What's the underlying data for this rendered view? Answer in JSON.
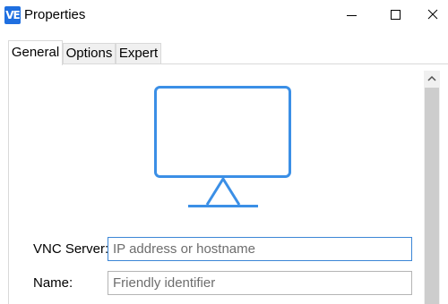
{
  "window": {
    "title": "Properties",
    "app_icon_text": "VE",
    "buttons": [
      "minimize-icon",
      "maximize-icon",
      "close-icon"
    ]
  },
  "tabs": [
    {
      "label": "General",
      "active": true
    },
    {
      "label": "Options",
      "active": false
    },
    {
      "label": "Expert",
      "active": false
    }
  ],
  "general": {
    "illustration": "monitor-icon",
    "vnc_server": {
      "label": "VNC Server:",
      "value": "",
      "placeholder": "IP address or hostname"
    },
    "name": {
      "label": "Name:",
      "value": "",
      "placeholder": "Friendly identifier"
    }
  },
  "colors": {
    "accent": "#3b8fe6",
    "app_icon": "#1f6fe0",
    "focused_border": "#3b86d6"
  }
}
